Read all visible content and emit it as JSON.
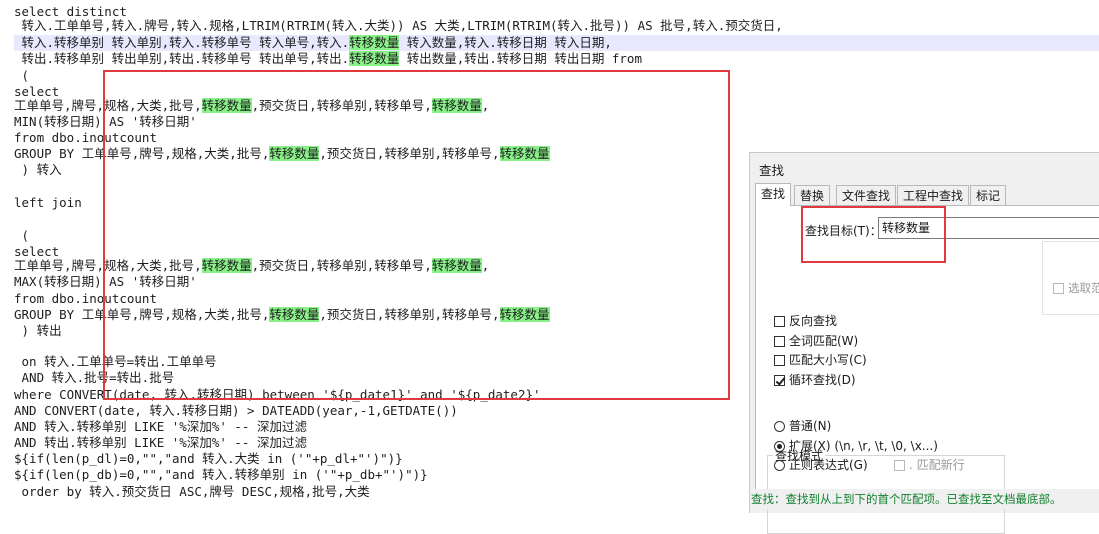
{
  "editor": {
    "lines": [
      [
        {
          "t": "select distinct"
        }
      ],
      [
        {
          "t": " 转入.工单单号,转入.牌号,转入.规格,LTRIM(RTRIM(转入.大类)) AS 大类,LTRIM(RTRIM(转入.批号)) AS 批号,转入.预交货日,"
        }
      ],
      [
        {
          "t": " 转入.转移单别 转入单别,转入.转移单号 转入单号,转入."
        },
        {
          "t": "转移数量",
          "h": true
        },
        {
          "t": " 转入数量,转入.转移日期 转入日期,"
        }
      ],
      [
        {
          "t": " 转出.转移单别 转出单别,转出.转移单号 转出单号,转出."
        },
        {
          "t": "转移数量",
          "h": true
        },
        {
          "t": " 转出数量,转出.转移日期 转出日期 from"
        }
      ],
      [
        {
          "t": " ("
        }
      ],
      [
        {
          "t": "select"
        }
      ],
      [
        {
          "t": "工单单号,牌号,规格,大类,批号,"
        },
        {
          "t": "转移数量",
          "h": true
        },
        {
          "t": ",预交货日,转移单别,转移单号,"
        },
        {
          "t": "转移数量",
          "h": true
        },
        {
          "t": ","
        }
      ],
      [
        {
          "t": "MIN(转移日期) AS '转移日期'"
        }
      ],
      [
        {
          "t": "from dbo.inoutcount"
        }
      ],
      [
        {
          "t": "GROUP BY 工单单号,牌号,规格,大类,批号,"
        },
        {
          "t": "转移数量",
          "h": true
        },
        {
          "t": ",预交货日,转移单别,转移单号,"
        },
        {
          "t": "转移数量",
          "h": true
        }
      ],
      [
        {
          "t": " ) 转入"
        }
      ],
      [
        {
          "t": ""
        }
      ],
      [
        {
          "t": "left join"
        }
      ],
      [
        {
          "t": ""
        }
      ],
      [
        {
          "t": " ("
        }
      ],
      [
        {
          "t": "select"
        }
      ],
      [
        {
          "t": "工单单号,牌号,规格,大类,批号,"
        },
        {
          "t": "转移数量",
          "h": true
        },
        {
          "t": ",预交货日,转移单别,转移单号,"
        },
        {
          "t": "转移数量",
          "h": true
        },
        {
          "t": ","
        }
      ],
      [
        {
          "t": "MAX(转移日期) AS '转移日期'"
        }
      ],
      [
        {
          "t": "from dbo.inoutcount"
        }
      ],
      [
        {
          "t": "GROUP BY 工单单号,牌号,规格,大类,批号,"
        },
        {
          "t": "转移数量",
          "h": true
        },
        {
          "t": ",预交货日,转移单别,转移单号,"
        },
        {
          "t": "转移数量",
          "h": true
        }
      ],
      [
        {
          "t": " ) 转出"
        }
      ],
      [
        {
          "t": ""
        }
      ],
      [
        {
          "t": " on 转入.工单单号=转出.工单单号"
        }
      ],
      [
        {
          "t": " AND 转入.批号=转出.批号"
        }
      ],
      [
        {
          "t": "where CONVERT(date, 转入.转移日期) between '${p_date1}' and '${p_date2}'"
        }
      ],
      [
        {
          "t": "AND CONVERT(date, 转入.转移日期) > DATEADD(year,-1,GETDATE())"
        }
      ],
      [
        {
          "t": "AND 转入.转移单别 LIKE '%深加%' -- 深加过滤"
        }
      ],
      [
        {
          "t": "AND 转出.转移单别 LIKE '%深加%' -- 深加过滤"
        }
      ],
      [
        {
          "t": "${if(len(p_dl)=0,\"\",\"and 转入.大类 in ('\"+p_dl+\"')\")}"
        }
      ],
      [
        {
          "t": "${if(len(p_db)=0,\"\",\"and 转入.转移单别 in ('\"+p_db+\"')\")}"
        }
      ],
      [
        {
          "t": " order by 转入.预交货日 ASC,牌号 DESC,规格,批号,大类"
        }
      ]
    ]
  },
  "find": {
    "title": "查找",
    "tabs": [
      "查找",
      "替换",
      "文件查找",
      "工程中查找",
      "标记"
    ],
    "target_label": "查找目标(T)：",
    "target_value": "转移数量",
    "in_selection_label": "选取范",
    "options": [
      {
        "label": "反向查找",
        "checked": false
      },
      {
        "label": "全词匹配(W)",
        "checked": false
      },
      {
        "label": "匹配大小写(C)",
        "checked": false
      },
      {
        "label": "循环查找(D)",
        "checked": true
      }
    ],
    "mode_title": "查找模式",
    "modes": [
      {
        "label": "普通(N)",
        "checked": false
      },
      {
        "label": "扩展(X) (\\n, \\r, \\t, \\0, \\x...)",
        "checked": true
      },
      {
        "label": "正则表达式(G)",
        "checked": false
      }
    ],
    "dot_newline_label": ". 匹配新行",
    "status": "查找：查找到从上到下的首个匹配项。已查找至文档最底部。"
  },
  "colors": {
    "highlight": "#88f288",
    "annotation_box": "#e0393e",
    "status_text": "#0f7f2c"
  }
}
